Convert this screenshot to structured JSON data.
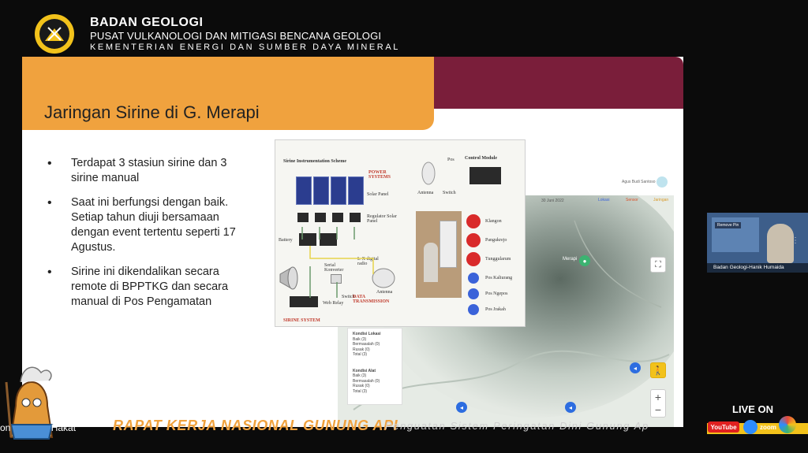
{
  "header": {
    "org_line1": "BADAN GEOLOGI",
    "org_line2": "PUSAT VULKANOLOGI DAN MITIGASI BENCANA GEOLOGI",
    "org_line3": "KEMENTERIAN ENERGI DAN SUMBER DAYA MINERAL"
  },
  "slide": {
    "title": "Jaringan Sirine di G. Merapi",
    "bullets": [
      "Terdapat 3 stasiun sirine dan 3 sirine manual",
      "Saat ini berfungsi dengan baik. Setiap tahun diuji bersamaan dengan event tertentu seperti 17 Agustus.",
      "Sirine ini dikendalikan secara remote di BPPTKG dan secara manual di Pos Pengamatan"
    ],
    "scheme": {
      "title": "Sirine Instrumentation Scheme",
      "power": "POWER SYSTEMS",
      "solar": "Solar Panel",
      "regulator": "Regulator Solar Panel",
      "battery": "Battery",
      "serial": "Serial Konverter",
      "radio": "L-X digital radio",
      "antenna": "Antenna",
      "switch": "Switch",
      "relay": "Web Relay",
      "data": "DATA TRANSMISSION",
      "system": "SIRINE SYSTEM",
      "pos": "Pos",
      "control": "Control Module",
      "legend_red": [
        "Klangon",
        "Pangukrejo",
        "Tunggularum"
      ],
      "legend_blue": [
        "Pos Kaliurang",
        "Pos Ngepos",
        "Pos Jrakah"
      ]
    },
    "map": {
      "user": "Agus Budi Santoso",
      "date": "30 Juni 2022",
      "filters": [
        "Lokasi",
        "Sensor",
        "Jaringan"
      ],
      "mountain": "Merapi",
      "panel1_title": "Kondisi Lokasi",
      "panel1_items": [
        "Baik (3)",
        "Bermasalah (0)",
        "Rusak (0)",
        "Total (3)"
      ],
      "panel2_title": "Kondisi Alat",
      "panel2_items": [
        "Baik (3)",
        "Bermasalah (0)",
        "Rusak (0)",
        "Total (3)"
      ],
      "zoom_in": "+",
      "zoom_out": "−"
    }
  },
  "thumbnail": {
    "name": "Badan Geologi-Hanik Humaida",
    "button": "Remove Pin"
  },
  "footer": {
    "left_partial": "on",
    "left_partial2": "Hakat",
    "title": "RAPAT KERJA NASIONAL GUNUNG API",
    "subtitle": "Penguatan Sistem Peringatan Dini Gunung Ap",
    "live": "LIVE ON",
    "youtube": "YouTube",
    "zoom": "zoom"
  }
}
